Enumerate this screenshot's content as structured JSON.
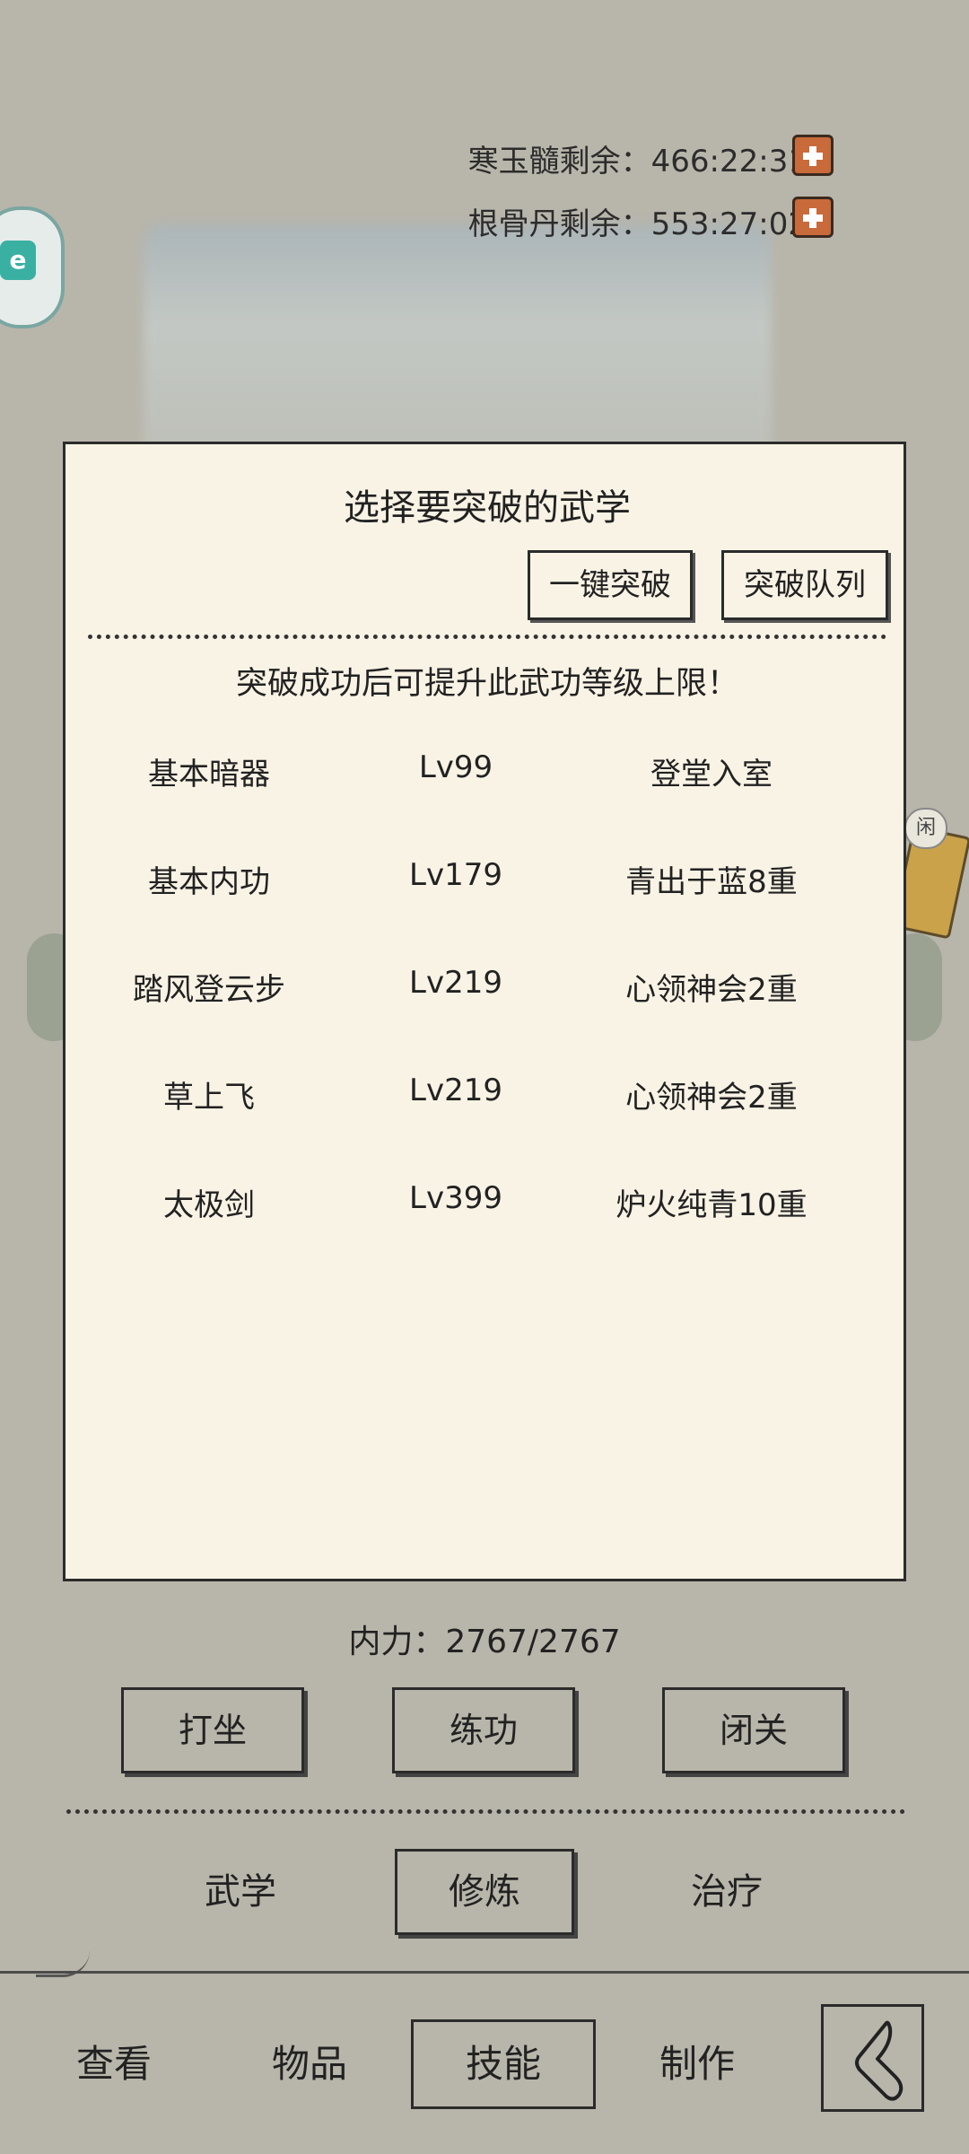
{
  "timers": {
    "hanyusui": "寒玉髓剩余：466:22:31",
    "gengudan": "根骨丹剩余：553:27:02"
  },
  "float_icon_text": "e",
  "side_chip_text": "闲",
  "dialog": {
    "title": "选择要突破的武学",
    "btn_one_key": "一键突破",
    "btn_queue": "突破队列",
    "hint": "突破成功后可提升此武功等级上限！",
    "skills": [
      {
        "name": "基本暗器",
        "level": "Lv99",
        "rank": "登堂入室"
      },
      {
        "name": "基本内功",
        "level": "Lv179",
        "rank": "青出于蓝8重"
      },
      {
        "name": "踏风登云步",
        "level": "Lv219",
        "rank": "心领神会2重"
      },
      {
        "name": "草上飞",
        "level": "Lv219",
        "rank": "心领神会2重"
      },
      {
        "name": "太极剑",
        "level": "Lv399",
        "rank": "炉火纯青10重"
      }
    ]
  },
  "neili": "内力：2767/2767",
  "actions": {
    "dazuo": "打坐",
    "liangong": "练功",
    "biguan": "闭关"
  },
  "subtabs": {
    "wuxue": "武学",
    "xiulian": "修炼",
    "zhiliao": "治疗"
  },
  "nav": {
    "chakan": "查看",
    "wupin": "物品",
    "jineng": "技能",
    "zhizuo": "制作"
  },
  "icons": {
    "plus": "plus-icon",
    "back": "back-icon"
  }
}
